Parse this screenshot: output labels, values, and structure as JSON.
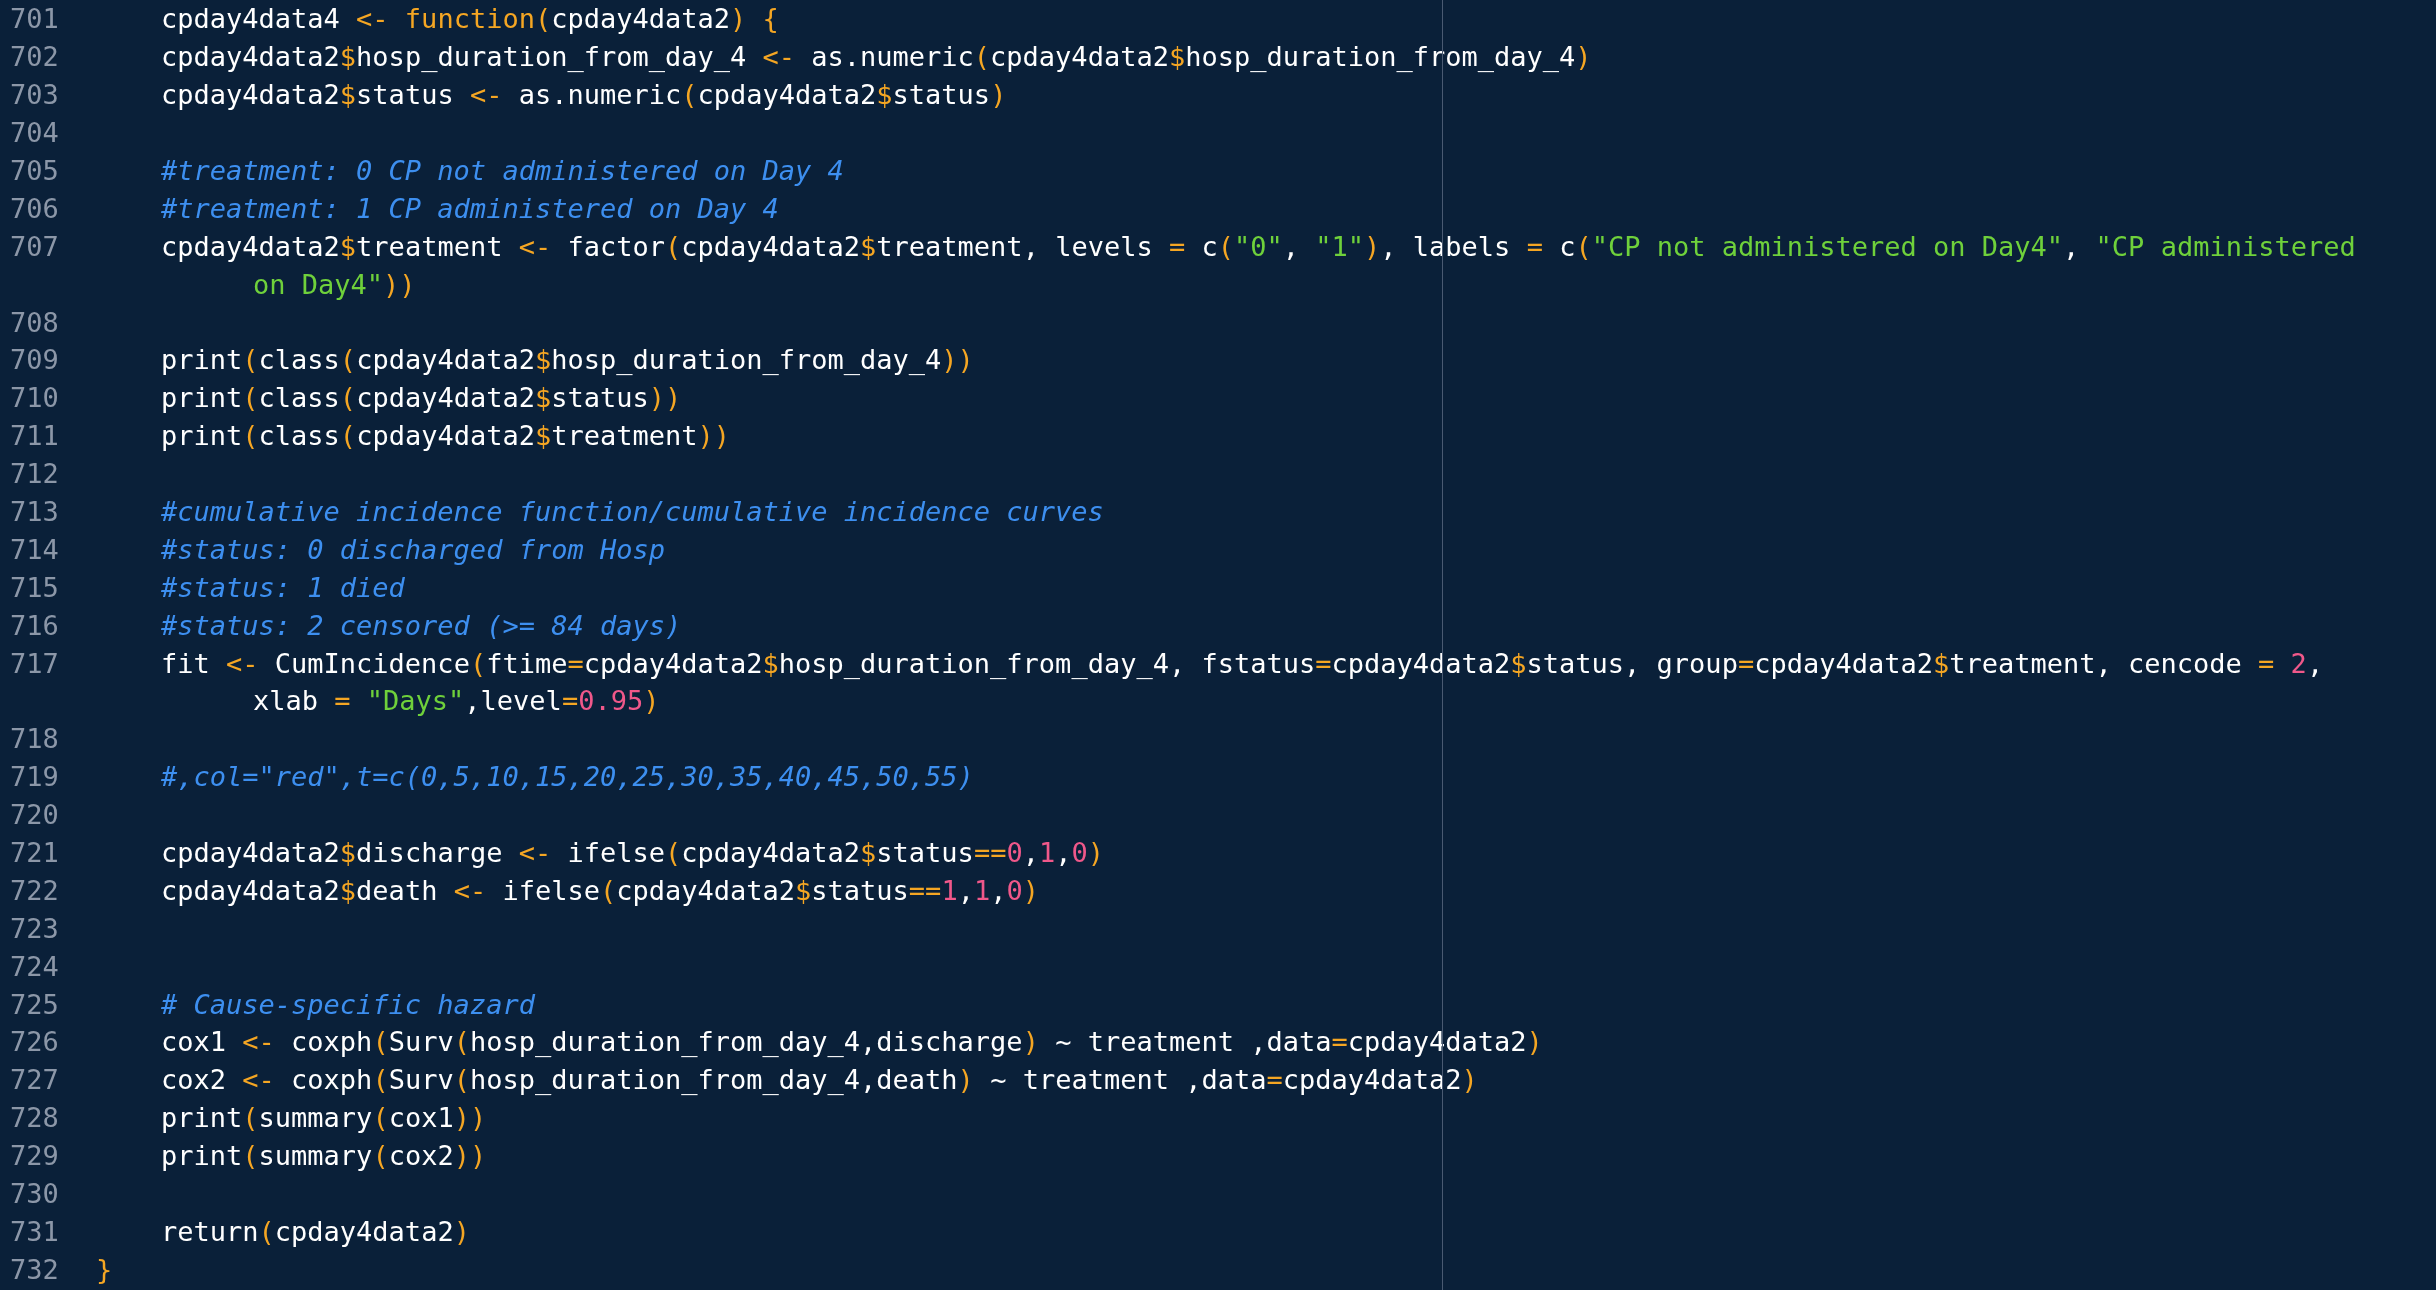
{
  "editor": {
    "lines": [
      {
        "number": "701",
        "rows": [
          {
            "tokens": [
              {
                "kind": "plain",
                "text": "    cpday4data4 "
              },
              {
                "kind": "op",
                "text": "<-"
              },
              {
                "kind": "kw",
                "text": " function"
              },
              {
                "kind": "op",
                "text": "("
              },
              {
                "kind": "plain",
                "text": "cpday4data2"
              },
              {
                "kind": "op",
                "text": ")"
              },
              {
                "kind": "op",
                "text": " {"
              }
            ]
          }
        ]
      },
      {
        "number": "702",
        "rows": [
          {
            "tokens": [
              {
                "kind": "plain",
                "text": "    cpday4data2"
              },
              {
                "kind": "op",
                "text": "$"
              },
              {
                "kind": "plain",
                "text": "hosp_duration_from_day_4 "
              },
              {
                "kind": "op",
                "text": "<-"
              },
              {
                "kind": "plain",
                "text": " as.numeric"
              },
              {
                "kind": "op",
                "text": "("
              },
              {
                "kind": "plain",
                "text": "cpday4data2"
              },
              {
                "kind": "op",
                "text": "$"
              },
              {
                "kind": "plain",
                "text": "hosp_duration_from_day_4"
              },
              {
                "kind": "op",
                "text": ")"
              }
            ]
          }
        ]
      },
      {
        "number": "703",
        "rows": [
          {
            "tokens": [
              {
                "kind": "plain",
                "text": "    cpday4data2"
              },
              {
                "kind": "op",
                "text": "$"
              },
              {
                "kind": "plain",
                "text": "status "
              },
              {
                "kind": "op",
                "text": "<-"
              },
              {
                "kind": "plain",
                "text": " as.numeric"
              },
              {
                "kind": "op",
                "text": "("
              },
              {
                "kind": "plain",
                "text": "cpday4data2"
              },
              {
                "kind": "op",
                "text": "$"
              },
              {
                "kind": "plain",
                "text": "status"
              },
              {
                "kind": "op",
                "text": ")"
              }
            ]
          }
        ]
      },
      {
        "number": "704"
      },
      {
        "number": "705",
        "rows": [
          {
            "tokens": [
              {
                "kind": "comment",
                "text": "    #treatment: 0 CP not administered on Day 4"
              }
            ]
          }
        ]
      },
      {
        "number": "706",
        "rows": [
          {
            "tokens": [
              {
                "kind": "comment",
                "text": "    #treatment: 1 CP administered on Day 4"
              }
            ]
          }
        ]
      },
      {
        "number": "707",
        "rows": [
          {
            "tokens": [
              {
                "kind": "plain",
                "text": "    cpday4data2"
              },
              {
                "kind": "op",
                "text": "$"
              },
              {
                "kind": "plain",
                "text": "treatment "
              },
              {
                "kind": "op",
                "text": "<-"
              },
              {
                "kind": "plain",
                "text": " factor"
              },
              {
                "kind": "op",
                "text": "("
              },
              {
                "kind": "plain",
                "text": "cpday4data2"
              },
              {
                "kind": "op",
                "text": "$"
              },
              {
                "kind": "plain",
                "text": "treatment, levels "
              },
              {
                "kind": "op",
                "text": "="
              },
              {
                "kind": "plain",
                "text": " c"
              },
              {
                "kind": "op",
                "text": "("
              },
              {
                "kind": "str",
                "text": "\"0\""
              },
              {
                "kind": "plain",
                "text": ", "
              },
              {
                "kind": "str",
                "text": "\"1\""
              },
              {
                "kind": "op",
                "text": ")"
              },
              {
                "kind": "plain",
                "text": ", labels "
              },
              {
                "kind": "op",
                "text": "="
              },
              {
                "kind": "plain",
                "text": " c"
              },
              {
                "kind": "op",
                "text": "("
              },
              {
                "kind": "str",
                "text": "\"CP not administered on Day4\""
              },
              {
                "kind": "plain",
                "text": ", "
              },
              {
                "kind": "str",
                "text": "\"CP administered"
              }
            ]
          },
          {
            "tokens": [
              {
                "kind": "str",
                "text": "on Day4\""
              },
              {
                "kind": "op",
                "text": "))"
              }
            ]
          }
        ]
      },
      {
        "number": "708"
      },
      {
        "number": "709",
        "rows": [
          {
            "tokens": [
              {
                "kind": "plain",
                "text": "    print"
              },
              {
                "kind": "op",
                "text": "("
              },
              {
                "kind": "plain",
                "text": "class"
              },
              {
                "kind": "op",
                "text": "("
              },
              {
                "kind": "plain",
                "text": "cpday4data2"
              },
              {
                "kind": "op",
                "text": "$"
              },
              {
                "kind": "plain",
                "text": "hosp_duration_from_day_4"
              },
              {
                "kind": "op",
                "text": "))"
              }
            ]
          }
        ]
      },
      {
        "number": "710",
        "rows": [
          {
            "tokens": [
              {
                "kind": "plain",
                "text": "    print"
              },
              {
                "kind": "op",
                "text": "("
              },
              {
                "kind": "plain",
                "text": "class"
              },
              {
                "kind": "op",
                "text": "("
              },
              {
                "kind": "plain",
                "text": "cpday4data2"
              },
              {
                "kind": "op",
                "text": "$"
              },
              {
                "kind": "plain",
                "text": "status"
              },
              {
                "kind": "op",
                "text": "))"
              }
            ]
          }
        ]
      },
      {
        "number": "711",
        "rows": [
          {
            "tokens": [
              {
                "kind": "plain",
                "text": "    print"
              },
              {
                "kind": "op",
                "text": "("
              },
              {
                "kind": "plain",
                "text": "class"
              },
              {
                "kind": "op",
                "text": "("
              },
              {
                "kind": "plain",
                "text": "cpday4data2"
              },
              {
                "kind": "op",
                "text": "$"
              },
              {
                "kind": "plain",
                "text": "treatment"
              },
              {
                "kind": "op",
                "text": "))"
              }
            ]
          }
        ]
      },
      {
        "number": "712"
      },
      {
        "number": "713",
        "rows": [
          {
            "tokens": [
              {
                "kind": "comment",
                "text": "    #cumulative incidence function/cumulative incidence curves"
              }
            ]
          }
        ]
      },
      {
        "number": "714",
        "rows": [
          {
            "tokens": [
              {
                "kind": "comment",
                "text": "    #status: 0 discharged from Hosp"
              }
            ]
          }
        ]
      },
      {
        "number": "715",
        "rows": [
          {
            "tokens": [
              {
                "kind": "comment",
                "text": "    #status: 1 died"
              }
            ]
          }
        ]
      },
      {
        "number": "716",
        "rows": [
          {
            "tokens": [
              {
                "kind": "comment",
                "text": "    #status: 2 censored (>= 84 days)"
              }
            ]
          }
        ]
      },
      {
        "number": "717",
        "rows": [
          {
            "tokens": [
              {
                "kind": "plain",
                "text": "    fit "
              },
              {
                "kind": "op",
                "text": "<-"
              },
              {
                "kind": "plain",
                "text": " CumIncidence"
              },
              {
                "kind": "op",
                "text": "("
              },
              {
                "kind": "plain",
                "text": "ftime"
              },
              {
                "kind": "op",
                "text": "="
              },
              {
                "kind": "plain",
                "text": "cpday4data2"
              },
              {
                "kind": "op",
                "text": "$"
              },
              {
                "kind": "plain",
                "text": "hosp_duration_from_day_4, fstatus"
              },
              {
                "kind": "op",
                "text": "="
              },
              {
                "kind": "plain",
                "text": "cpday4data2"
              },
              {
                "kind": "op",
                "text": "$"
              },
              {
                "kind": "plain",
                "text": "status, group"
              },
              {
                "kind": "op",
                "text": "="
              },
              {
                "kind": "plain",
                "text": "cpday4data2"
              },
              {
                "kind": "op",
                "text": "$"
              },
              {
                "kind": "plain",
                "text": "treatment, cencode "
              },
              {
                "kind": "op",
                "text": "="
              },
              {
                "kind": "num",
                "text": " 2"
              },
              {
                "kind": "plain",
                "text": ","
              }
            ]
          },
          {
            "tokens": [
              {
                "kind": "plain",
                "text": "xlab "
              },
              {
                "kind": "op",
                "text": "="
              },
              {
                "kind": "str",
                "text": " \"Days\""
              },
              {
                "kind": "plain",
                "text": ",level"
              },
              {
                "kind": "op",
                "text": "="
              },
              {
                "kind": "num",
                "text": "0.95"
              },
              {
                "kind": "op",
                "text": ")"
              }
            ]
          }
        ]
      },
      {
        "number": "718"
      },
      {
        "number": "719",
        "rows": [
          {
            "tokens": [
              {
                "kind": "comment",
                "text": "    #,col=\"red\",t=c(0,5,10,15,20,25,30,35,40,45,50,55)"
              }
            ]
          }
        ]
      },
      {
        "number": "720"
      },
      {
        "number": "721",
        "rows": [
          {
            "tokens": [
              {
                "kind": "plain",
                "text": "    cpday4data2"
              },
              {
                "kind": "op",
                "text": "$"
              },
              {
                "kind": "plain",
                "text": "discharge "
              },
              {
                "kind": "op",
                "text": "<-"
              },
              {
                "kind": "plain",
                "text": " ifelse"
              },
              {
                "kind": "op",
                "text": "("
              },
              {
                "kind": "plain",
                "text": "cpday4data2"
              },
              {
                "kind": "op",
                "text": "$"
              },
              {
                "kind": "plain",
                "text": "status"
              },
              {
                "kind": "op",
                "text": "=="
              },
              {
                "kind": "num",
                "text": "0"
              },
              {
                "kind": "plain",
                "text": ","
              },
              {
                "kind": "num",
                "text": "1"
              },
              {
                "kind": "plain",
                "text": ","
              },
              {
                "kind": "num",
                "text": "0"
              },
              {
                "kind": "op",
                "text": ")"
              }
            ]
          }
        ]
      },
      {
        "number": "722",
        "rows": [
          {
            "tokens": [
              {
                "kind": "plain",
                "text": "    cpday4data2"
              },
              {
                "kind": "op",
                "text": "$"
              },
              {
                "kind": "plain",
                "text": "death "
              },
              {
                "kind": "op",
                "text": "<-"
              },
              {
                "kind": "plain",
                "text": " ifelse"
              },
              {
                "kind": "op",
                "text": "("
              },
              {
                "kind": "plain",
                "text": "cpday4data2"
              },
              {
                "kind": "op",
                "text": "$"
              },
              {
                "kind": "plain",
                "text": "status"
              },
              {
                "kind": "op",
                "text": "=="
              },
              {
                "kind": "num",
                "text": "1"
              },
              {
                "kind": "plain",
                "text": ","
              },
              {
                "kind": "num",
                "text": "1"
              },
              {
                "kind": "plain",
                "text": ","
              },
              {
                "kind": "num",
                "text": "0"
              },
              {
                "kind": "op",
                "text": ")"
              }
            ]
          }
        ]
      },
      {
        "number": "723"
      },
      {
        "number": "724"
      },
      {
        "number": "725",
        "rows": [
          {
            "tokens": [
              {
                "kind": "comment",
                "text": "    # Cause-specific hazard"
              }
            ]
          }
        ]
      },
      {
        "number": "726",
        "rows": [
          {
            "tokens": [
              {
                "kind": "plain",
                "text": "    cox1 "
              },
              {
                "kind": "op",
                "text": "<-"
              },
              {
                "kind": "plain",
                "text": " coxph"
              },
              {
                "kind": "op",
                "text": "("
              },
              {
                "kind": "plain",
                "text": "Surv"
              },
              {
                "kind": "op",
                "text": "("
              },
              {
                "kind": "plain",
                "text": "hosp_duration_from_day_4,discharge"
              },
              {
                "kind": "op",
                "text": ")"
              },
              {
                "kind": "plain",
                "text": " ~ treatment ,data"
              },
              {
                "kind": "op",
                "text": "="
              },
              {
                "kind": "plain",
                "text": "cpday4data2"
              },
              {
                "kind": "op",
                "text": ")"
              }
            ]
          }
        ]
      },
      {
        "number": "727",
        "rows": [
          {
            "tokens": [
              {
                "kind": "plain",
                "text": "    cox2 "
              },
              {
                "kind": "op",
                "text": "<-"
              },
              {
                "kind": "plain",
                "text": " coxph"
              },
              {
                "kind": "op",
                "text": "("
              },
              {
                "kind": "plain",
                "text": "Surv"
              },
              {
                "kind": "op",
                "text": "("
              },
              {
                "kind": "plain",
                "text": "hosp_duration_from_day_4,death"
              },
              {
                "kind": "op",
                "text": ")"
              },
              {
                "kind": "plain",
                "text": " ~ treatment ,data"
              },
              {
                "kind": "op",
                "text": "="
              },
              {
                "kind": "plain",
                "text": "cpday4data2"
              },
              {
                "kind": "op",
                "text": ")"
              }
            ]
          }
        ]
      },
      {
        "number": "728",
        "rows": [
          {
            "tokens": [
              {
                "kind": "plain",
                "text": "    print"
              },
              {
                "kind": "op",
                "text": "("
              },
              {
                "kind": "plain",
                "text": "summary"
              },
              {
                "kind": "op",
                "text": "("
              },
              {
                "kind": "plain",
                "text": "cox1"
              },
              {
                "kind": "op",
                "text": "))"
              }
            ]
          }
        ]
      },
      {
        "number": "729",
        "rows": [
          {
            "tokens": [
              {
                "kind": "plain",
                "text": "    print"
              },
              {
                "kind": "op",
                "text": "("
              },
              {
                "kind": "plain",
                "text": "summary"
              },
              {
                "kind": "op",
                "text": "("
              },
              {
                "kind": "plain",
                "text": "cox2"
              },
              {
                "kind": "op",
                "text": "))"
              }
            ]
          }
        ]
      },
      {
        "number": "730"
      },
      {
        "number": "731",
        "rows": [
          {
            "tokens": [
              {
                "kind": "plain",
                "text": "    return"
              },
              {
                "kind": "op",
                "text": "("
              },
              {
                "kind": "plain",
                "text": "cpday4data2"
              },
              {
                "kind": "op",
                "text": ")"
              }
            ]
          }
        ]
      },
      {
        "number": "732",
        "rows": [
          {
            "tokens": [
              {
                "kind": "op",
                "text": "}"
              }
            ]
          }
        ]
      }
    ]
  }
}
